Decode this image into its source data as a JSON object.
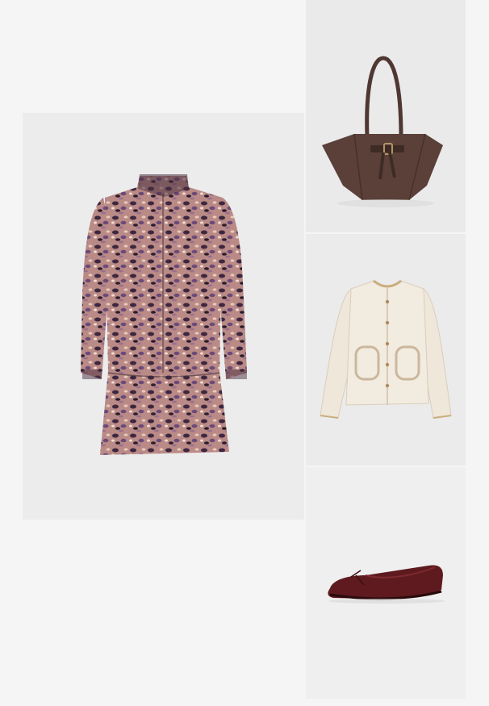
{
  "collage": {
    "products": [
      {
        "id": "dress",
        "kind": "print-shirt-dress",
        "color": "#8a5a5e"
      },
      {
        "id": "bag",
        "kind": "leather-tote-bag",
        "color": "#5a4039"
      },
      {
        "id": "jacket",
        "kind": "quilted-jacket",
        "color": "#efe7da"
      },
      {
        "id": "shoe",
        "kind": "ballet-flat",
        "color": "#5e1a1f"
      }
    ],
    "background_color": "#f5f5f5",
    "panel_color": "#ececec"
  }
}
